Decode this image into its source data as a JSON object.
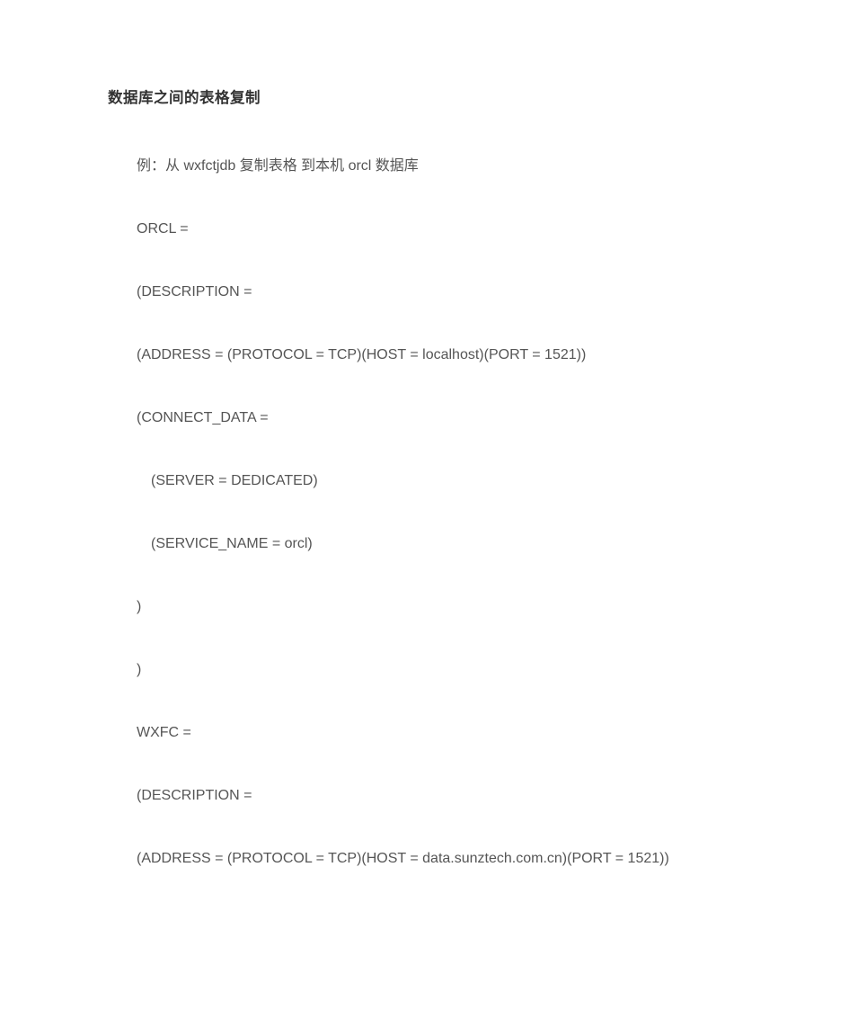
{
  "doc": {
    "title": "数据库之间的表格复制",
    "lines": [
      "例：从 wxfctjdb 复制表格 到本机 orcl 数据库",
      "ORCL =",
      "(DESCRIPTION =",
      "(ADDRESS = (PROTOCOL = TCP)(HOST = localhost)(PORT = 1521))",
      "(CONNECT_DATA =",
      "(SERVER = DEDICATED)",
      "(SERVICE_NAME = orcl)",
      ")",
      ")",
      "WXFC =",
      "(DESCRIPTION =",
      "(ADDRESS = (PROTOCOL = TCP)(HOST = data.sunztech.com.cn)(PORT = 1521))"
    ]
  }
}
